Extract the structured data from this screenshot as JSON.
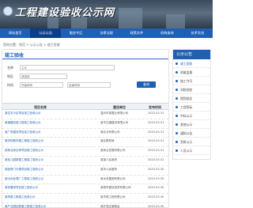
{
  "header": {
    "title": "工程建设验收公示网"
  },
  "nav": {
    "items": [
      "网站首页",
      "公示公告",
      "服务专区",
      "法律法规",
      "政策文件",
      "机构查询",
      "技术交流"
    ],
    "active_index": 1
  },
  "breadcrumb": "您的位置：首页 > 公示公告 > 竣工验收",
  "main": {
    "heading": "竣工验收",
    "form": {
      "name_label": "名称",
      "name_placeholder": "名称",
      "region_label": "地区",
      "region_placeholder": "请选择",
      "time_label": "时间",
      "time_from": "开始时间",
      "time_to": "结束时间",
      "search_label": "查询"
    },
    "table": {
      "headers": [
        "项目名称",
        "建设单位",
        "发布时间"
      ],
      "rows": [
        {
          "name": "某住宅小区项目竣工验收公示",
          "unit": "温州市某置业有限公司",
          "date": "2023-03-31"
        },
        {
          "name": "某道路改造工程竣工验收公示",
          "unit": "某市交通建设有限公司",
          "date": "2023-03-31"
        },
        {
          "name": "某厂房建设项目竣工验收公示",
          "unit": "某实业有限公司",
          "date": "2023-03-31"
        },
        {
          "name": "某学校教学楼工程竣工验收公示",
          "unit": "某区教育局",
          "date": "2023-03-31"
        },
        {
          "name": "某商业综合体项目竣工验收公示",
          "unit": "某商业发展有限公司",
          "date": "2023-03-31"
        },
        {
          "name": "某幼儿园新建工程竣工验收公示",
          "unit": "某镇人民政府",
          "date": "2023-03-31"
        },
        {
          "name": "某医院门诊楼项目竣工验收公示",
          "unit": "某市人民医院",
          "date": "2023-03-30"
        },
        {
          "name": "某污水处理厂工程竣工验收公示",
          "unit": "某水务集团有限公司",
          "date": "2023-03-30"
        },
        {
          "name": "某安置房项目竣工验收公示",
          "unit": "某城市建设投资有限公司",
          "date": "2023-03-30"
        },
        {
          "name": "某桥梁工程竣工验收公示",
          "unit": "某市政工程有限公司",
          "date": "2023-03-30"
        },
        {
          "name": "某产业园区配套工程竣工验收公示",
          "unit": "某开发区管委会",
          "date": "2023-03-30"
        }
      ]
    }
  },
  "sidebar": {
    "heading": "公示公告",
    "items": [
      "竣工验收",
      "质量监督",
      "施工许可",
      "消防验收",
      "规划核实",
      "工程招标",
      "中标公示",
      "其他公示",
      "通知公告",
      "资质公示",
      "人员公示"
    ],
    "active_index": 0
  }
}
